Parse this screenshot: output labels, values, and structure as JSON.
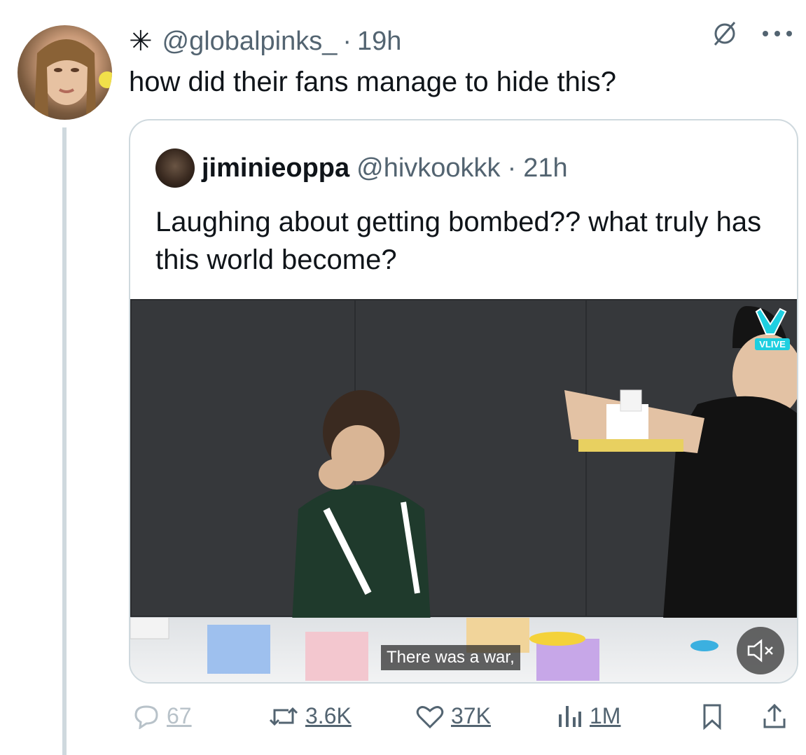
{
  "tweet": {
    "prefix_icon": "asterisk-icon",
    "handle": "@globalpinks_",
    "separator": "·",
    "time": "19h",
    "text": "how did their fans manage to hide this?"
  },
  "quoted": {
    "name": "jiminieoppa",
    "handle": "@hivkookkk",
    "separator": "·",
    "time": "21h",
    "text": "Laughing about getting bombed?? what truly has this world become?"
  },
  "media": {
    "watermark_label": "VLIVE",
    "subtitle": "There was a war,",
    "mute_icon": "speaker-mute-icon"
  },
  "actions": {
    "replies": "67",
    "reposts": "3.6K",
    "likes": "37K",
    "views": "1M"
  },
  "colors": {
    "text_primary": "#0f1419",
    "text_secondary": "#536471",
    "border": "#cfd9de",
    "vlive": "#1ecfe0"
  }
}
